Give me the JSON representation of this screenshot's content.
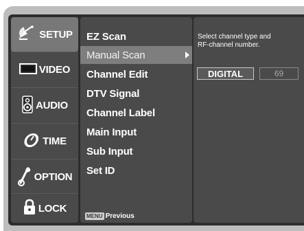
{
  "categories": [
    {
      "label": "SETUP",
      "icon": "satellite-dish-icon",
      "active": true
    },
    {
      "label": "VIDEO",
      "icon": "tv-screen-icon",
      "active": false
    },
    {
      "label": "AUDIO",
      "icon": "speaker-icon",
      "active": false
    },
    {
      "label": "TIME",
      "icon": "clock-icon",
      "active": false
    },
    {
      "label": "OPTION",
      "icon": "wrench-icon",
      "active": false
    },
    {
      "label": "LOCK",
      "icon": "padlock-icon",
      "active": false
    }
  ],
  "menu": {
    "items": [
      {
        "label": "EZ Scan"
      },
      {
        "label": "Manual Scan",
        "selected": true
      },
      {
        "label": "Channel Edit"
      },
      {
        "label": "DTV Signal"
      },
      {
        "label": "Channel Label"
      },
      {
        "label": "Main Input"
      },
      {
        "label": "Sub Input"
      },
      {
        "label": "Set ID"
      }
    ],
    "footer_key": "MENU",
    "footer_label": "Previous"
  },
  "detail": {
    "hint_line1": "Select channel type and",
    "hint_line2": "RF-channel number.",
    "channel_type": "DIGITAL",
    "rf_channel": "69"
  },
  "colors": {
    "panel": "#2d2d2d",
    "column": "#4a4a4a",
    "highlight": "#7e7e7e",
    "frame": "#bdbdbd"
  }
}
